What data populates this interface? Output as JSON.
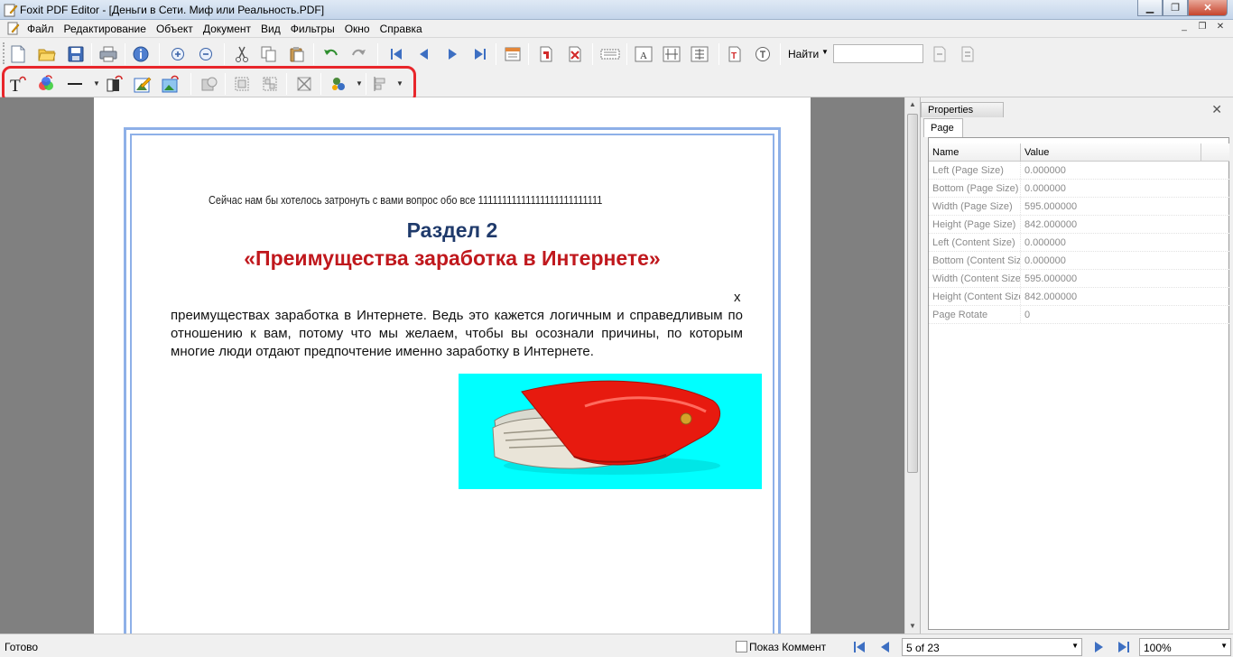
{
  "window": {
    "title": "Foxit PDF Editor - [Деньги в Сети. Миф или Реальность.PDF]",
    "minimize": "▁",
    "maximize": "❐",
    "close": "✕"
  },
  "menu": {
    "items": [
      "Файл",
      "Редактирование",
      "Объект",
      "Документ",
      "Вид",
      "Фильтры",
      "Окно",
      "Справка"
    ],
    "mdi_minimize": "_",
    "mdi_restore": "❐",
    "mdi_close": "✕"
  },
  "toolbar": {
    "find_label": "Найти",
    "find_value": ""
  },
  "document": {
    "line1": "Сейчас нам бы хотелось затронуть с вами вопрос обо все 11111111111111111111111111",
    "heading1": "Раздел 2",
    "heading2": "«Преимущества заработка в Интернете»",
    "stray_char": "х",
    "paragraph": "преимуществах заработка в Интернете. Ведь это кажется логичным и справедливым по отношению к вам, потому что мы желаем, чтобы вы осознали причины, по которым многие люди отдают предпочтение именно заработку в Интернете."
  },
  "properties": {
    "title": "Properties",
    "tab": "Page",
    "col_name": "Name",
    "col_value": "Value",
    "rows": [
      {
        "name": "Left (Page Size)",
        "value": "0.000000"
      },
      {
        "name": "Bottom (Page Size)",
        "value": "0.000000"
      },
      {
        "name": "Width (Page Size)",
        "value": "595.000000"
      },
      {
        "name": "Height (Page Size)",
        "value": "842.000000"
      },
      {
        "name": "Left (Content Size)",
        "value": "0.000000"
      },
      {
        "name": "Bottom (Content Size)",
        "value": "0.000000"
      },
      {
        "name": "Width (Content Size)",
        "value": "595.000000"
      },
      {
        "name": "Height (Content Size)",
        "value": "842.000000"
      },
      {
        "name": "Page Rotate",
        "value": "0"
      }
    ]
  },
  "status": {
    "text": "Готово",
    "show_comments_label": "Показ Коммент",
    "page_indicator": "5 of 23",
    "zoom": "100%"
  },
  "colors": {
    "highlight": "#e8262b",
    "heading_blue": "#1f3a6b",
    "heading_red": "#c0181d",
    "frame": "#8eb0e8",
    "image_bg": "#00ffff"
  }
}
